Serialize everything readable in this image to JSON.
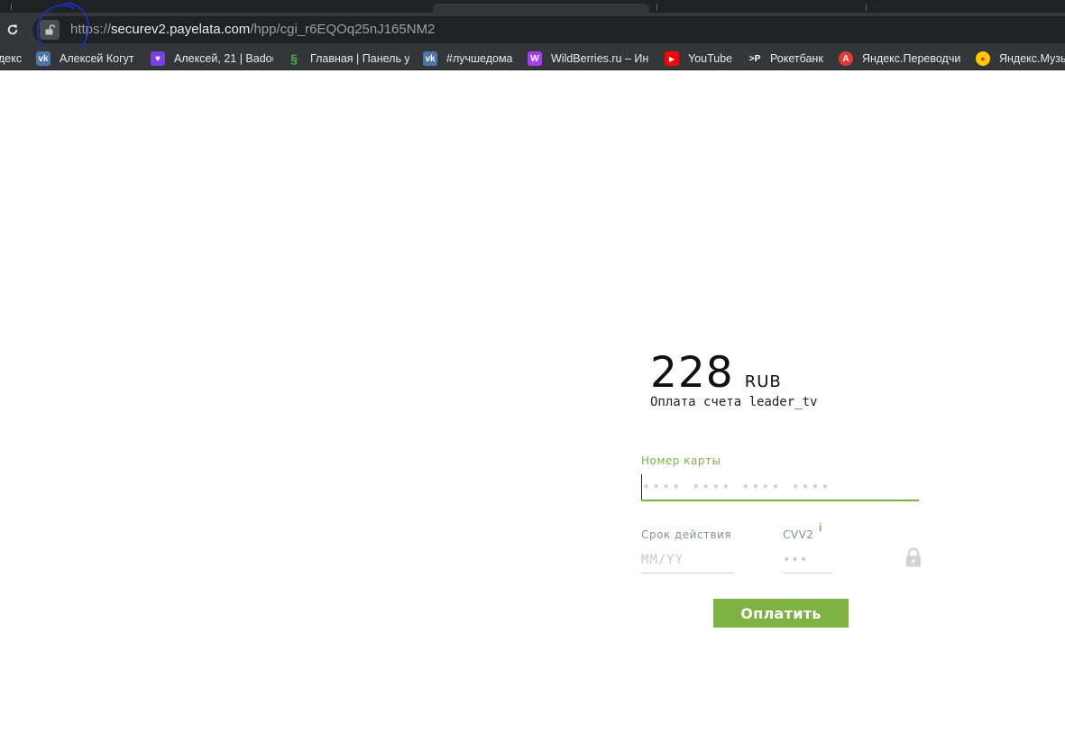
{
  "browser": {
    "address_bar": {
      "scheme": "https://",
      "host": "securev2.payelata.com",
      "path": "/hpp/cgi_r6EQOq25nJ165NM2"
    },
    "bookmarks": [
      {
        "label": "декс",
        "icon": "yandex-icon",
        "color": "#35363a"
      },
      {
        "label": "Алексей Когут",
        "icon": "vk-icon",
        "color": "#4a76a8"
      },
      {
        "label": "Алексей, 21 | Badoo",
        "icon": "badoo-icon",
        "color": "#7b3fe4"
      },
      {
        "label": "Главная | Панель у",
        "icon": "green-s-icon",
        "color": "#35363a"
      },
      {
        "label": "#лучшедома",
        "icon": "vk-icon",
        "color": "#4a76a8"
      },
      {
        "label": "WildBerries.ru – Ин",
        "icon": "wildberries-icon",
        "color": "#a73afd"
      },
      {
        "label": "YouTube",
        "icon": "youtube-icon",
        "color": "#ff0000"
      },
      {
        "label": "Рокетбанк",
        "icon": "rocketbank-icon",
        "color": "#35363a"
      },
      {
        "label": "Яндекс.Переводчи",
        "icon": "yandex-translate-icon",
        "color": "#35363a"
      },
      {
        "label": "Яндекс.Музы",
        "icon": "yandex-music-icon",
        "color": "#35363a"
      }
    ],
    "bookmark_glyphs": {
      "vk": "vk",
      "badoo": "♥",
      "green_s": "§",
      "wildberries": "W",
      "youtube": "▶",
      "rocketbank": ">P",
      "translate": "A",
      "music": "●"
    }
  },
  "payment": {
    "amount": "228",
    "currency": "RUB",
    "description": "Оплата счета leader_tv",
    "card_number": {
      "label": "Номер карты",
      "placeholder": "•••• •••• •••• ••••",
      "value": ""
    },
    "expiry": {
      "label": "Срок действия",
      "placeholder": "MM/YY",
      "value": ""
    },
    "cvv": {
      "label": "CVV2",
      "info": "i",
      "placeholder": "•••",
      "value": ""
    },
    "submit_label": "Оплатить"
  },
  "colors": {
    "accent": "#7cb342",
    "chrome_dark": "#202124",
    "chrome_toolbar": "#35363a",
    "annotation": "#1a2fd1"
  }
}
